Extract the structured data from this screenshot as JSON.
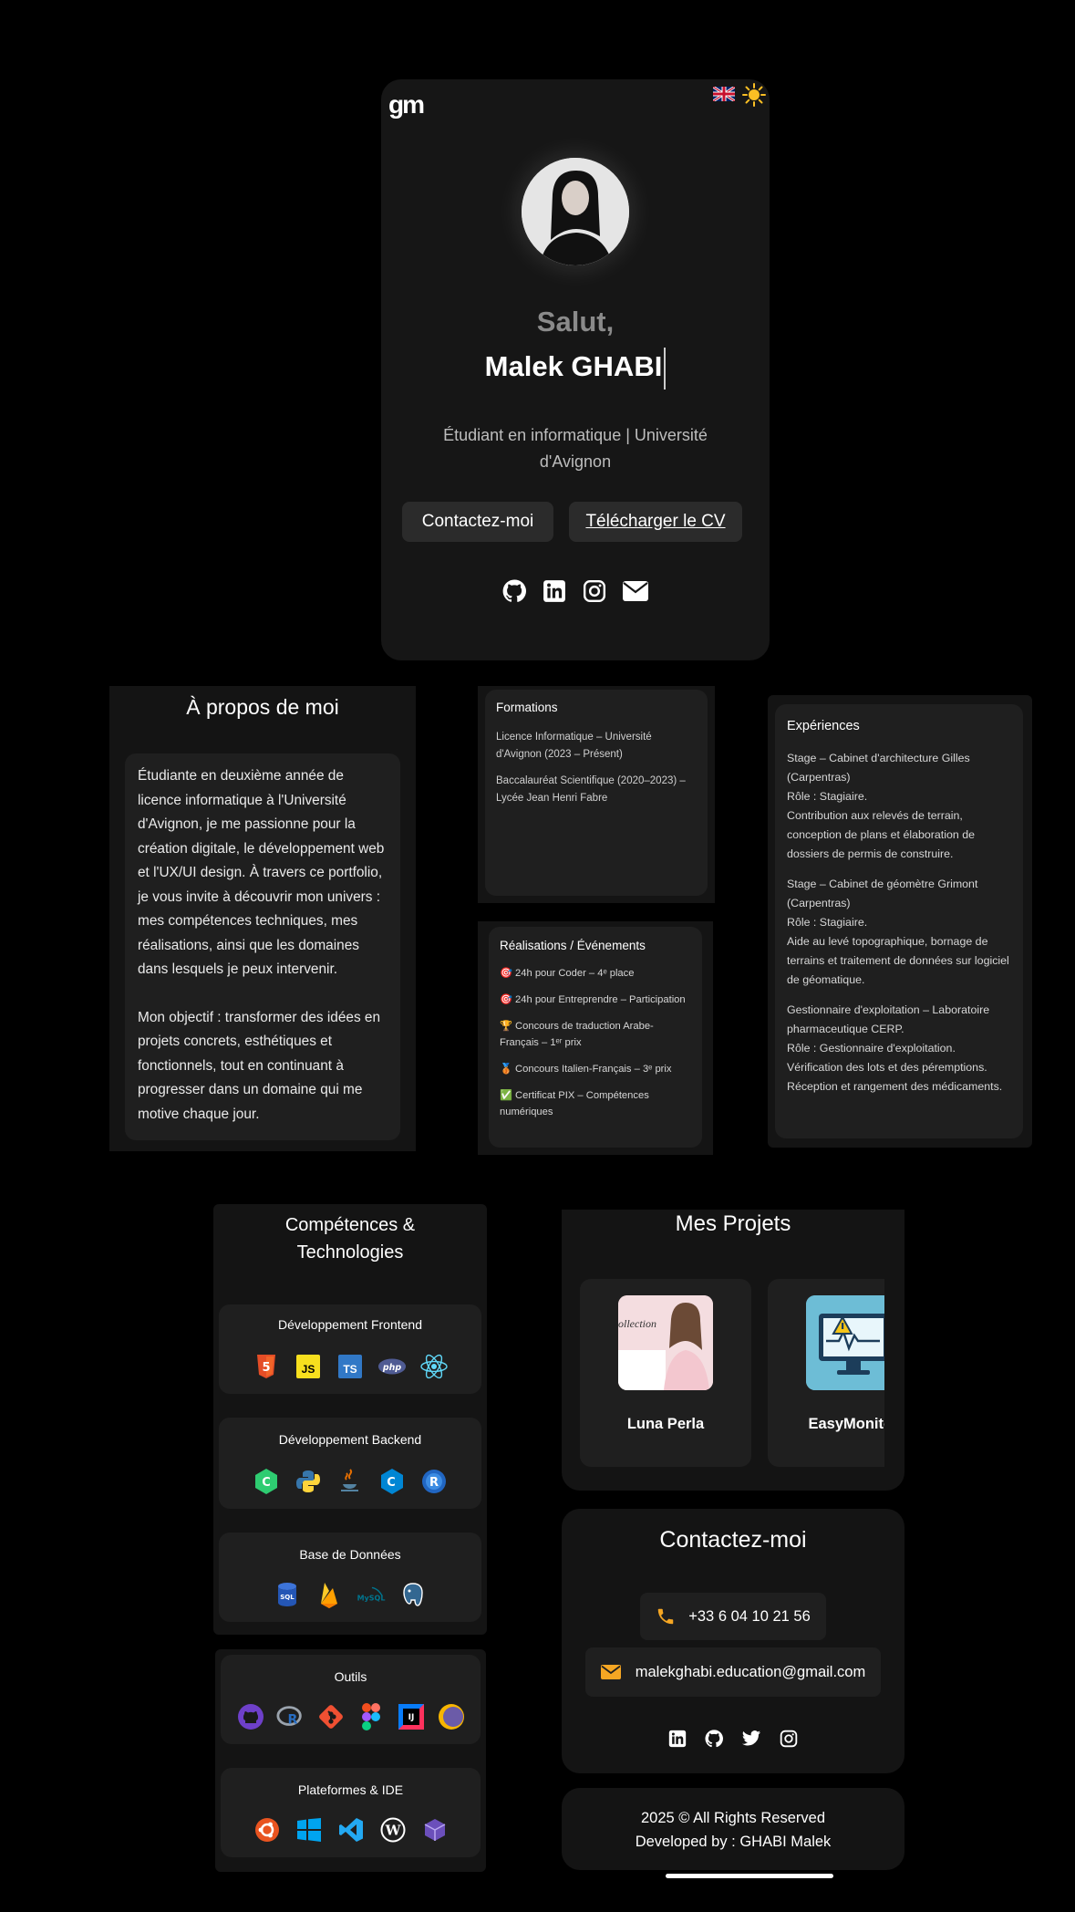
{
  "hero": {
    "logo_text": "gm",
    "greeting": "Salut,",
    "name": "Malek GHABI",
    "subtitle": "Étudiant en informatique | Université d'Avignon",
    "contact_button": "Contactez-moi",
    "cv_button": "Télécharger le CV",
    "flag_icon": "uk-flag-icon",
    "theme_icon": "sun-icon",
    "social_icons": [
      "github-icon",
      "linkedin-icon",
      "instagram-icon",
      "mail-icon"
    ]
  },
  "about": {
    "title": "À propos de moi",
    "paragraph1": "Étudiante en deuxième année de licence informatique à l'Université d'Avignon, je me passionne pour la création digitale, le développement web et l'UX/UI design. À travers ce portfolio, je vous invite à découvrir mon univers : mes compétences techniques, mes réalisations, ainsi que les domaines dans lesquels je peux intervenir.",
    "paragraph2": "Mon objectif : transformer des idées en projets concrets, esthétiques et fonctionnels, tout en continuant à progresser dans un domaine qui me motive chaque jour."
  },
  "formations": {
    "title": "Formations",
    "items": [
      "Licence Informatique – Université d'Avignon (2023 – Présent)",
      "Baccalauréat Scientifique (2020–2023) – Lycée Jean Henri Fabre"
    ]
  },
  "achievements": {
    "title": "Réalisations / Événements",
    "items": [
      {
        "emoji": "🎯",
        "text": "24h pour Coder – 4ᵉ place"
      },
      {
        "emoji": "🎯",
        "text": "24h pour Entreprendre – Participation"
      },
      {
        "emoji": "🏆",
        "text": "Concours de traduction Arabe-Français – 1ᵉʳ prix"
      },
      {
        "emoji": "🥉",
        "text": "Concours Italien-Français – 3ᵉ prix"
      },
      {
        "emoji": "✅",
        "text": "Certificat PIX – Compétences numériques"
      }
    ]
  },
  "experiences": {
    "title": "Expériences",
    "items": [
      {
        "title": "Stage – Cabinet d'architecture Gilles (Carpentras)",
        "role": "Rôle : Stagiaire.",
        "desc": "Contribution aux relevés de terrain, conception de plans et élaboration de dossiers de permis de construire."
      },
      {
        "title": "Stage – Cabinet de géomètre Grimont (Carpentras)",
        "role": "Rôle : Stagiaire.",
        "desc": "Aide au levé topographique, bornage de terrains et traitement de données sur logiciel de géomatique."
      },
      {
        "title": "Gestionnaire d'exploitation – Laboratoire pharmaceutique CERP.",
        "role": "Rôle : Gestionnaire d'exploitation.",
        "desc": "Vérification des lots et des péremptions. Réception et rangement des médicaments."
      }
    ]
  },
  "skills": {
    "title": "Compétences & Technologies",
    "groups": [
      {
        "title": "Développement Frontend",
        "icons": [
          "html5-icon",
          "javascript-icon",
          "typescript-icon",
          "php-icon",
          "react-icon"
        ]
      },
      {
        "title": "Développement Backend",
        "icons": [
          "csharp-icon",
          "python-icon",
          "java-icon",
          "cplusplus-icon",
          "r-icon"
        ]
      },
      {
        "title": "Base de Données",
        "icons": [
          "sql-icon",
          "firebase-icon",
          "mysql-icon",
          "postgresql-icon"
        ]
      },
      {
        "title": "Outils",
        "icons": [
          "github-icon",
          "rstudio-icon",
          "git-icon",
          "figma-icon",
          "intellij-icon",
          "eclipse-icon"
        ]
      },
      {
        "title": "Plateformes & IDE",
        "icons": [
          "ubuntu-icon",
          "windows-icon",
          "vscode-icon",
          "wordpress-icon",
          "virtualbox-icon"
        ]
      }
    ],
    "labels": {
      "js": "JS",
      "ts": "TS",
      "php": "php",
      "sql": "SQL",
      "mysql": "MySQL",
      "r": "R",
      "ij": "IJ"
    }
  },
  "projects": {
    "title": "Mes Projets",
    "items": [
      {
        "name": "Luna Perla",
        "image_text": "ollection",
        "image_icon": "jewelry-photo"
      },
      {
        "name": "EasyMonitor",
        "image_icon": "monitor-alert-icon"
      }
    ]
  },
  "contact": {
    "title": "Contactez-moi",
    "phone": "+33 6 04 10 21 56",
    "email": "malekghabi.education@gmail.com",
    "social_icons": [
      "linkedin-icon",
      "github-icon",
      "twitter-icon",
      "instagram-icon"
    ]
  },
  "footer": {
    "line1": "2025 © All Rights Reserved",
    "line2": "Developed by : GHABI Malek"
  },
  "colors": {
    "accent": "#f5a623",
    "card": "#141414",
    "inner": "#1f1f1f"
  }
}
